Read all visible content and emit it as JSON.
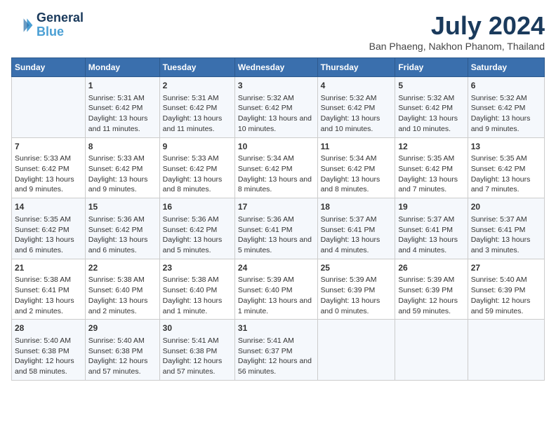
{
  "header": {
    "logo_line1": "General",
    "logo_line2": "Blue",
    "main_title": "July 2024",
    "sub_title": "Ban Phaeng, Nakhon Phanom, Thailand"
  },
  "columns": [
    "Sunday",
    "Monday",
    "Tuesday",
    "Wednesday",
    "Thursday",
    "Friday",
    "Saturday"
  ],
  "weeks": [
    [
      {
        "day": "",
        "sunrise": "",
        "sunset": "",
        "daylight": ""
      },
      {
        "day": "1",
        "sunrise": "Sunrise: 5:31 AM",
        "sunset": "Sunset: 6:42 PM",
        "daylight": "Daylight: 13 hours and 11 minutes."
      },
      {
        "day": "2",
        "sunrise": "Sunrise: 5:31 AM",
        "sunset": "Sunset: 6:42 PM",
        "daylight": "Daylight: 13 hours and 11 minutes."
      },
      {
        "day": "3",
        "sunrise": "Sunrise: 5:32 AM",
        "sunset": "Sunset: 6:42 PM",
        "daylight": "Daylight: 13 hours and 10 minutes."
      },
      {
        "day": "4",
        "sunrise": "Sunrise: 5:32 AM",
        "sunset": "Sunset: 6:42 PM",
        "daylight": "Daylight: 13 hours and 10 minutes."
      },
      {
        "day": "5",
        "sunrise": "Sunrise: 5:32 AM",
        "sunset": "Sunset: 6:42 PM",
        "daylight": "Daylight: 13 hours and 10 minutes."
      },
      {
        "day": "6",
        "sunrise": "Sunrise: 5:32 AM",
        "sunset": "Sunset: 6:42 PM",
        "daylight": "Daylight: 13 hours and 9 minutes."
      }
    ],
    [
      {
        "day": "7",
        "sunrise": "Sunrise: 5:33 AM",
        "sunset": "Sunset: 6:42 PM",
        "daylight": "Daylight: 13 hours and 9 minutes."
      },
      {
        "day": "8",
        "sunrise": "Sunrise: 5:33 AM",
        "sunset": "Sunset: 6:42 PM",
        "daylight": "Daylight: 13 hours and 9 minutes."
      },
      {
        "day": "9",
        "sunrise": "Sunrise: 5:33 AM",
        "sunset": "Sunset: 6:42 PM",
        "daylight": "Daylight: 13 hours and 8 minutes."
      },
      {
        "day": "10",
        "sunrise": "Sunrise: 5:34 AM",
        "sunset": "Sunset: 6:42 PM",
        "daylight": "Daylight: 13 hours and 8 minutes."
      },
      {
        "day": "11",
        "sunrise": "Sunrise: 5:34 AM",
        "sunset": "Sunset: 6:42 PM",
        "daylight": "Daylight: 13 hours and 8 minutes."
      },
      {
        "day": "12",
        "sunrise": "Sunrise: 5:35 AM",
        "sunset": "Sunset: 6:42 PM",
        "daylight": "Daylight: 13 hours and 7 minutes."
      },
      {
        "day": "13",
        "sunrise": "Sunrise: 5:35 AM",
        "sunset": "Sunset: 6:42 PM",
        "daylight": "Daylight: 13 hours and 7 minutes."
      }
    ],
    [
      {
        "day": "14",
        "sunrise": "Sunrise: 5:35 AM",
        "sunset": "Sunset: 6:42 PM",
        "daylight": "Daylight: 13 hours and 6 minutes."
      },
      {
        "day": "15",
        "sunrise": "Sunrise: 5:36 AM",
        "sunset": "Sunset: 6:42 PM",
        "daylight": "Daylight: 13 hours and 6 minutes."
      },
      {
        "day": "16",
        "sunrise": "Sunrise: 5:36 AM",
        "sunset": "Sunset: 6:42 PM",
        "daylight": "Daylight: 13 hours and 5 minutes."
      },
      {
        "day": "17",
        "sunrise": "Sunrise: 5:36 AM",
        "sunset": "Sunset: 6:41 PM",
        "daylight": "Daylight: 13 hours and 5 minutes."
      },
      {
        "day": "18",
        "sunrise": "Sunrise: 5:37 AM",
        "sunset": "Sunset: 6:41 PM",
        "daylight": "Daylight: 13 hours and 4 minutes."
      },
      {
        "day": "19",
        "sunrise": "Sunrise: 5:37 AM",
        "sunset": "Sunset: 6:41 PM",
        "daylight": "Daylight: 13 hours and 4 minutes."
      },
      {
        "day": "20",
        "sunrise": "Sunrise: 5:37 AM",
        "sunset": "Sunset: 6:41 PM",
        "daylight": "Daylight: 13 hours and 3 minutes."
      }
    ],
    [
      {
        "day": "21",
        "sunrise": "Sunrise: 5:38 AM",
        "sunset": "Sunset: 6:41 PM",
        "daylight": "Daylight: 13 hours and 2 minutes."
      },
      {
        "day": "22",
        "sunrise": "Sunrise: 5:38 AM",
        "sunset": "Sunset: 6:40 PM",
        "daylight": "Daylight: 13 hours and 2 minutes."
      },
      {
        "day": "23",
        "sunrise": "Sunrise: 5:38 AM",
        "sunset": "Sunset: 6:40 PM",
        "daylight": "Daylight: 13 hours and 1 minute."
      },
      {
        "day": "24",
        "sunrise": "Sunrise: 5:39 AM",
        "sunset": "Sunset: 6:40 PM",
        "daylight": "Daylight: 13 hours and 1 minute."
      },
      {
        "day": "25",
        "sunrise": "Sunrise: 5:39 AM",
        "sunset": "Sunset: 6:39 PM",
        "daylight": "Daylight: 13 hours and 0 minutes."
      },
      {
        "day": "26",
        "sunrise": "Sunrise: 5:39 AM",
        "sunset": "Sunset: 6:39 PM",
        "daylight": "Daylight: 12 hours and 59 minutes."
      },
      {
        "day": "27",
        "sunrise": "Sunrise: 5:40 AM",
        "sunset": "Sunset: 6:39 PM",
        "daylight": "Daylight: 12 hours and 59 minutes."
      }
    ],
    [
      {
        "day": "28",
        "sunrise": "Sunrise: 5:40 AM",
        "sunset": "Sunset: 6:38 PM",
        "daylight": "Daylight: 12 hours and 58 minutes."
      },
      {
        "day": "29",
        "sunrise": "Sunrise: 5:40 AM",
        "sunset": "Sunset: 6:38 PM",
        "daylight": "Daylight: 12 hours and 57 minutes."
      },
      {
        "day": "30",
        "sunrise": "Sunrise: 5:41 AM",
        "sunset": "Sunset: 6:38 PM",
        "daylight": "Daylight: 12 hours and 57 minutes."
      },
      {
        "day": "31",
        "sunrise": "Sunrise: 5:41 AM",
        "sunset": "Sunset: 6:37 PM",
        "daylight": "Daylight: 12 hours and 56 minutes."
      },
      {
        "day": "",
        "sunrise": "",
        "sunset": "",
        "daylight": ""
      },
      {
        "day": "",
        "sunrise": "",
        "sunset": "",
        "daylight": ""
      },
      {
        "day": "",
        "sunrise": "",
        "sunset": "",
        "daylight": ""
      }
    ]
  ]
}
